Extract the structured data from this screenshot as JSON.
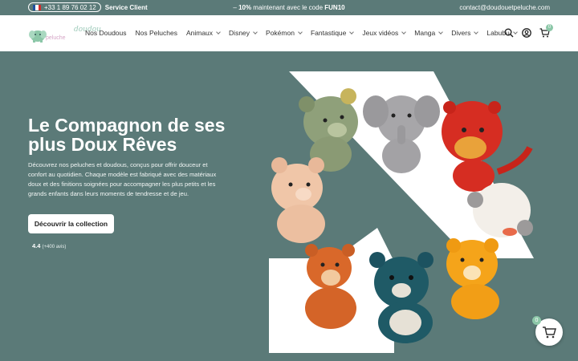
{
  "topbar": {
    "phone": "+33 1 89 76 02 12",
    "service": "Service Client",
    "promo_prefix": "– ",
    "promo_percent": "10%",
    "promo_mid": " maintenant avec le code ",
    "promo_code": "FUN10",
    "email": "contact@doudouetpeluche.com"
  },
  "header": {
    "logo_main": "doudou",
    "logo_sub": "peluche",
    "nav": [
      "Nos Doudous",
      "Nos Peluches",
      "Animaux",
      "Disney",
      "Pokémon",
      "Fantastique",
      "Jeux vidéos",
      "Manga",
      "Divers",
      "Labubu"
    ],
    "cart_count": "0"
  },
  "hero": {
    "title": "Le Compagnon de ses plus Doux Rêves",
    "text": "Découvrez nos peluches et doudous, conçus pour offrir douceur et confort au quotidien. Chaque modèle est fabriqué avec des matériaux doux et des finitions soignées pour accompagner les plus petits et les grands enfants dans leurs moments de tendresse et de jeu.",
    "cta": "Découvrir la collection",
    "rating": "4.4",
    "reviews": "(+400 avis)"
  },
  "floating_cart": {
    "count": "0"
  },
  "colors": {
    "brand_teal": "#5b7a78",
    "accent_green": "#8cc7a8"
  }
}
